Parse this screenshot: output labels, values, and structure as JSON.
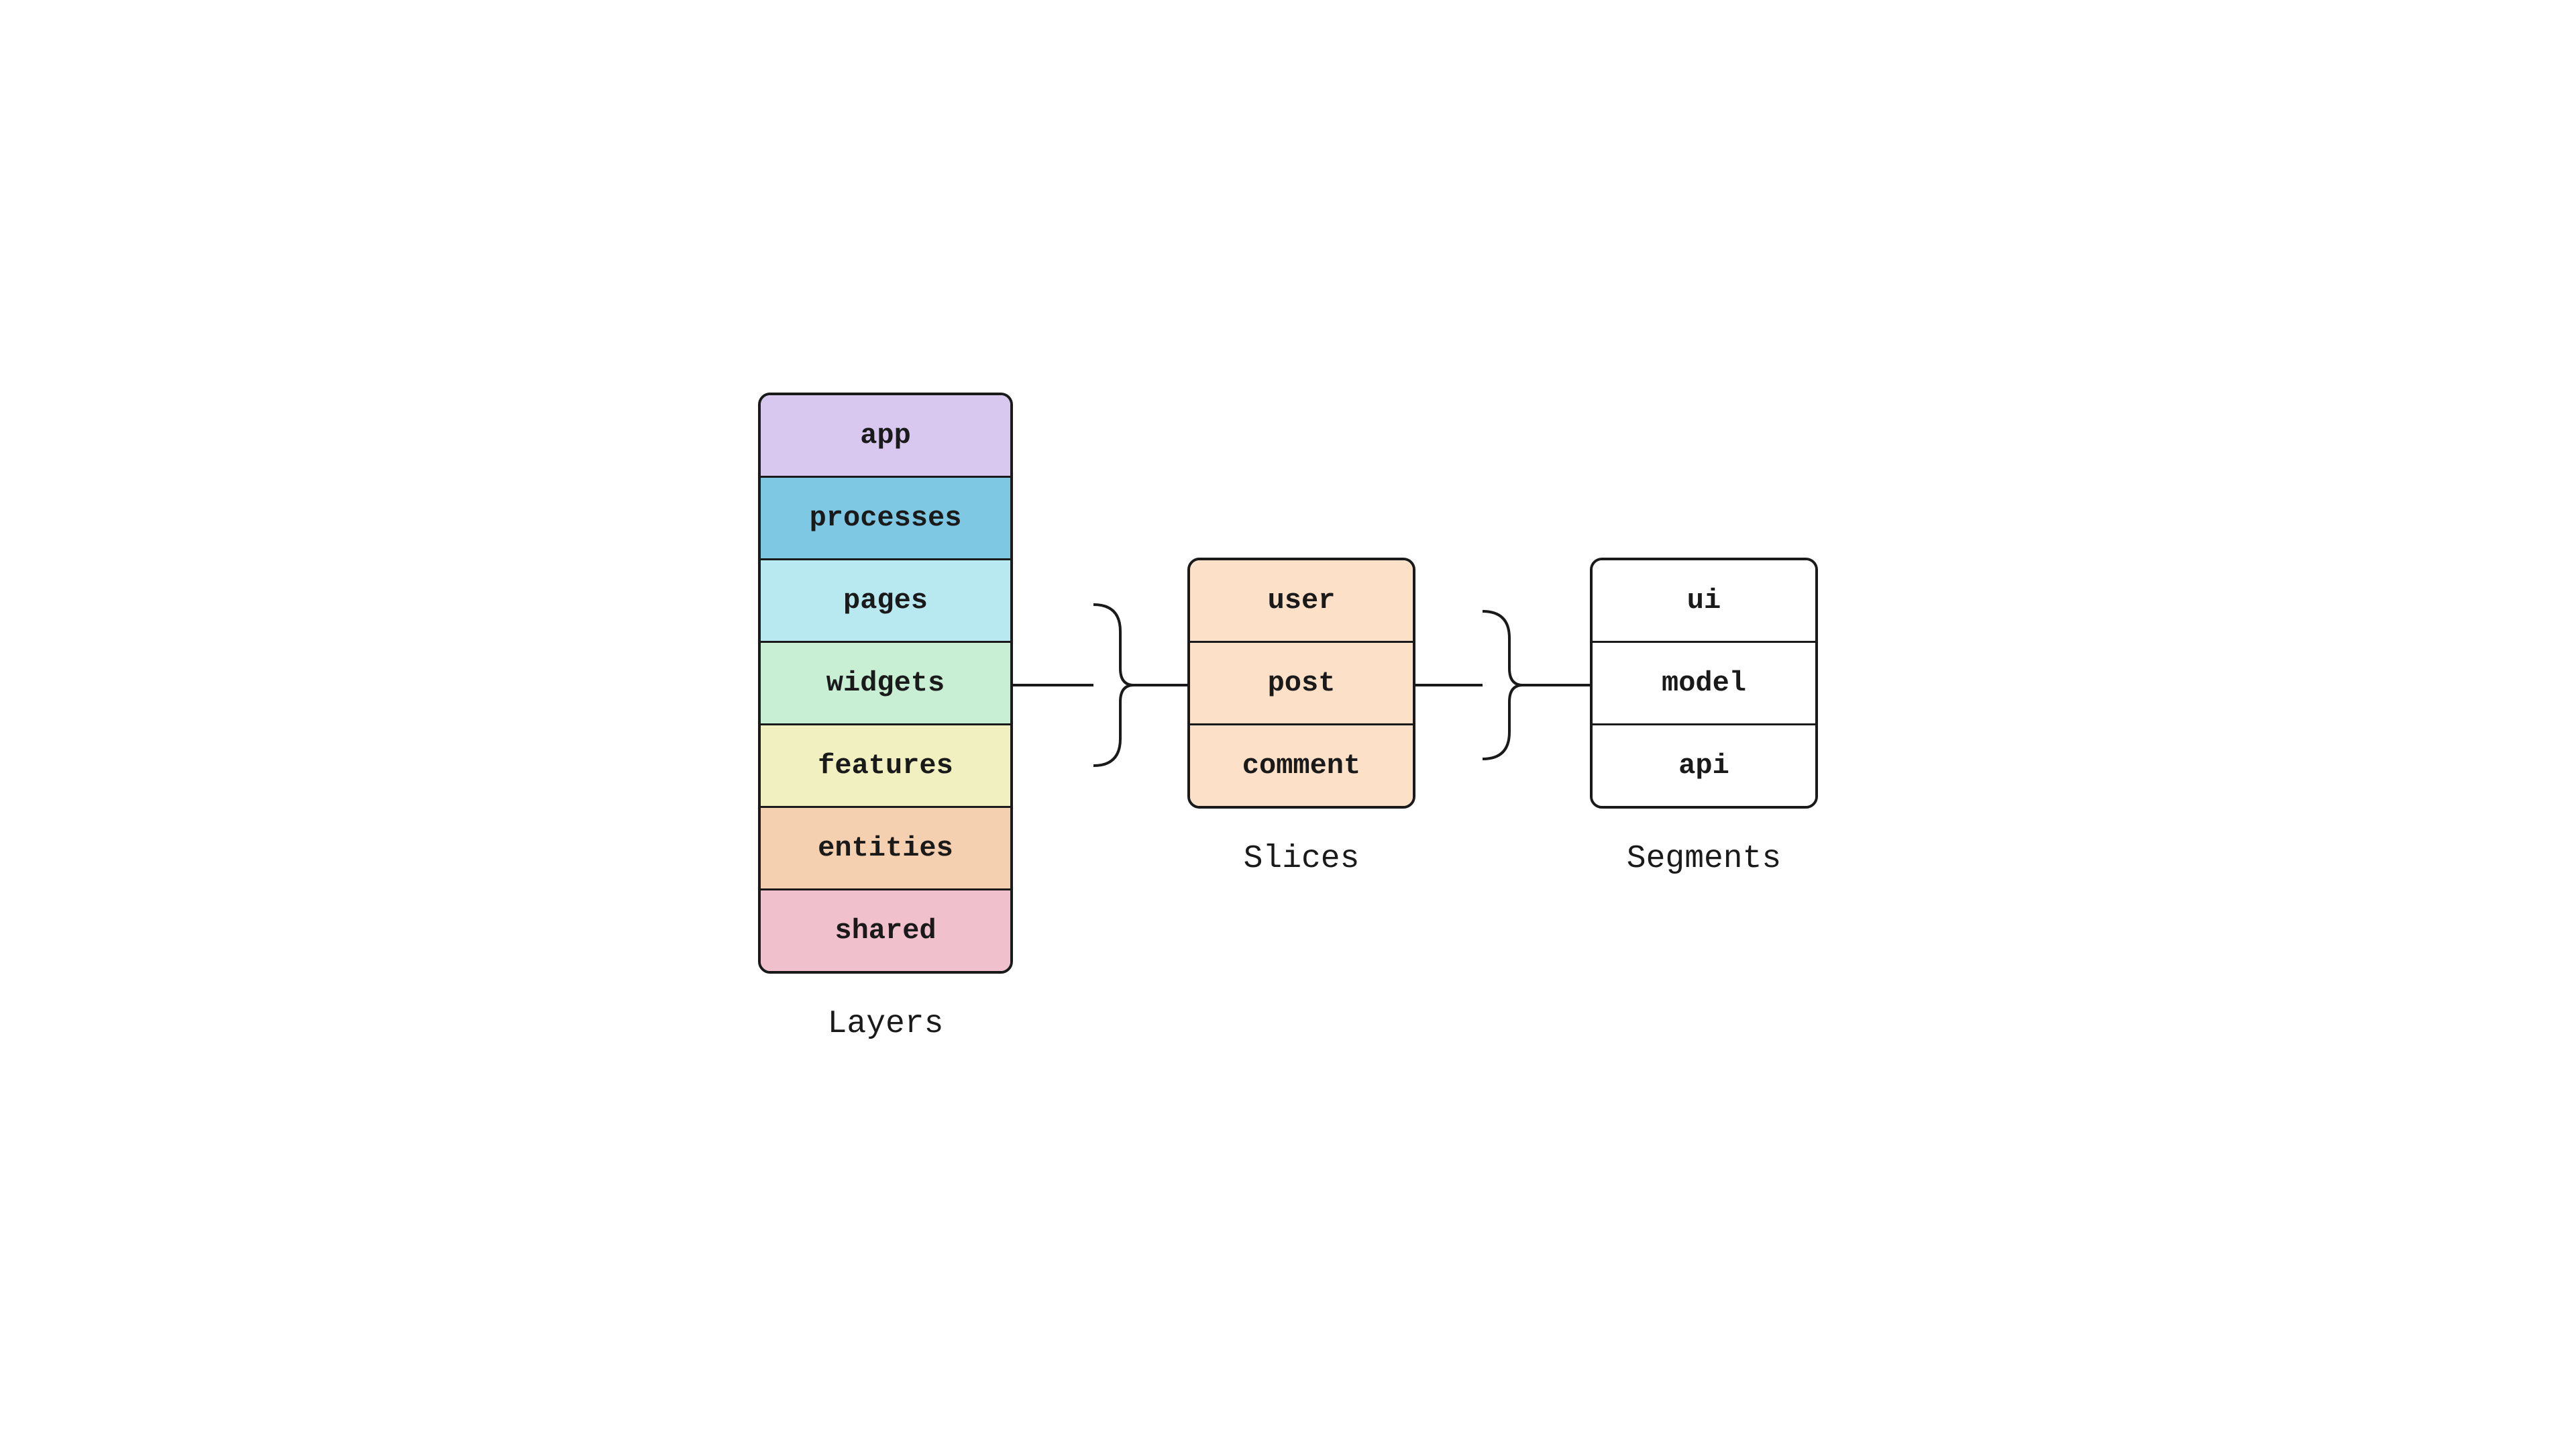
{
  "layers": {
    "label": "Layers",
    "items": [
      {
        "label": "app",
        "class": "layer-app"
      },
      {
        "label": "processes",
        "class": "layer-processes"
      },
      {
        "label": "pages",
        "class": "layer-pages"
      },
      {
        "label": "widgets",
        "class": "layer-widgets"
      },
      {
        "label": "features",
        "class": "layer-features"
      },
      {
        "label": "entities",
        "class": "layer-entities"
      },
      {
        "label": "shared",
        "class": "layer-shared"
      }
    ]
  },
  "slices": {
    "label": "Slices",
    "items": [
      {
        "label": "user"
      },
      {
        "label": "post"
      },
      {
        "label": "comment"
      }
    ]
  },
  "segments": {
    "label": "Segments",
    "items": [
      {
        "label": "ui"
      },
      {
        "label": "model"
      },
      {
        "label": "api"
      }
    ]
  }
}
